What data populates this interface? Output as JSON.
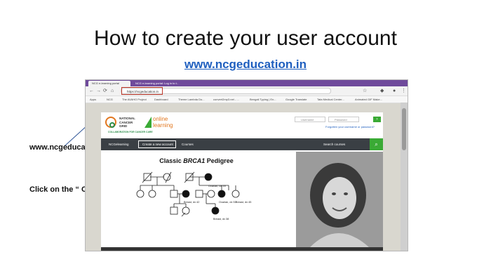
{
  "slide": {
    "title": "How to create your user account",
    "url": "www.ncgeducation.in",
    "callout_url": "www.ncgeducation.in",
    "callout_create": "Click on the “ Create a new account”"
  },
  "browser": {
    "tabs": [
      "NCG e-learning portal",
      "NCG e-learning portal: Log in to t..."
    ],
    "address": "https://ncgeducation.in",
    "bookmarks": [
      "Apps",
      "NCG",
      "The AVAHO Project",
      "Dashboard",
      "Theme Lambda Do...",
      "convert2mp3.net - ...",
      "Bengali Typing | En...",
      "Google Translate",
      "Tata Medical Center...",
      "Animated GIF Make..."
    ]
  },
  "site": {
    "logo_ncg_line1": "NATIONAL",
    "logo_ncg_line2": "CANCER",
    "logo_ncg_line3": "GRID",
    "logo_online": "online",
    "logo_learning": "learning",
    "collab": "COLLABORATION FOR CANCER CARE",
    "username_placeholder": "Username",
    "password_placeholder": "Password",
    "login_arrow": "›",
    "forgot": "Forgotten your username or password?",
    "nav": {
      "home": "NCGelearning",
      "create": "Create a new account",
      "courses": "Courses",
      "search": "Search courses",
      "search_icon": "search-icon"
    }
  },
  "pedigree": {
    "title_prefix": "Classic ",
    "title_gene": "BRCA1",
    "title_suffix": " Pedigree",
    "labels": [
      "Ovarian, dx 49",
      "Breast, dx 42",
      "Ovarian, dx 53",
      "Breast, dx 45",
      "Breast, dx 38"
    ]
  }
}
